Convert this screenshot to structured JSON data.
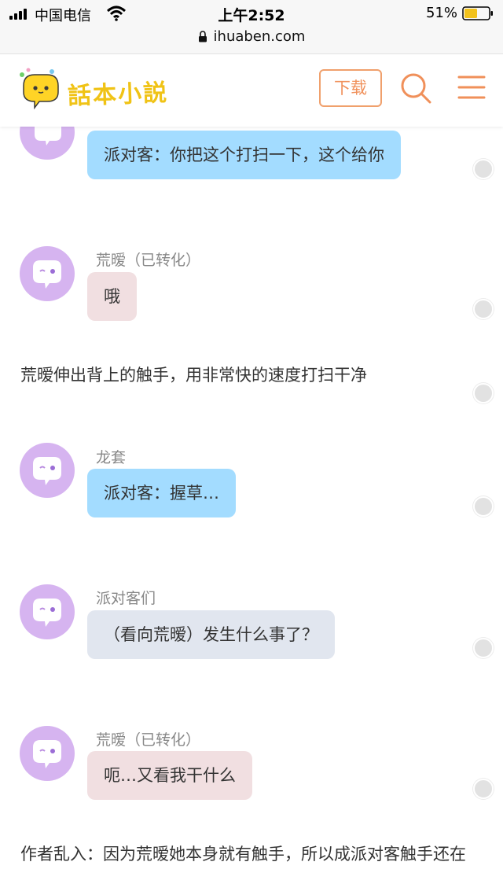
{
  "status_bar": {
    "carrier": "中国电信",
    "time": "上午2:52",
    "battery": "51%"
  },
  "url_bar": {
    "url": "ihuaben.com"
  },
  "header": {
    "logo_text": "話本小説",
    "download_label": "下载"
  },
  "chat": {
    "msg1": {
      "text": "派对客：你把这个打扫一下，这个给你"
    },
    "msg2": {
      "name": "荒暧（已转化）",
      "text": "哦"
    },
    "narration1": "荒暧伸出背上的触手，用非常快的速度打扫干净",
    "msg3": {
      "name": "龙套",
      "text": "派对客：握草…"
    },
    "msg4": {
      "name": "派对客们",
      "text": "（看向荒暧）发生什么事了？"
    },
    "msg5": {
      "name": "荒暧（已转化）",
      "text": "呃…又看我干什么"
    },
    "narration2": "作者乱入：因为荒暧她本身就有触手，所以成派对客触手还在"
  },
  "colors": {
    "accent": "#f0905a",
    "bubble_blue": "#a3dcff",
    "bubble_pink": "#f1dfe1",
    "bubble_grey": "#e1e6ef",
    "avatar": "#d6b4f0"
  }
}
